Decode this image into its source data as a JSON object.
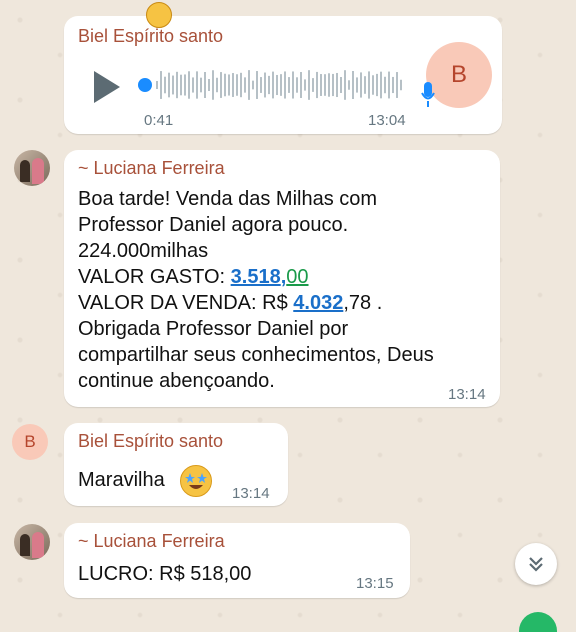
{
  "voice_message": {
    "sender": "Biel Espírito santo",
    "duration": "0:41",
    "time": "13:04",
    "avatar_letter": "B"
  },
  "message1": {
    "sender": "~ Luciana Ferreira",
    "line1": "Boa tarde! Venda das Milhas com",
    "line2": "Professor Daniel agora pouco.",
    "line3": "224.000milhas",
    "gasto_label": "VALOR GASTO: ",
    "gasto_int": "3.518",
    "gasto_sep": ",",
    "gasto_dec": "00",
    "venda_label": "VALOR DA VENDA: R$ ",
    "venda_int": "4.032",
    "venda_rest": ",78 .",
    "line6": "Obrigada Professor Daniel por",
    "line7": "compartilhar seus conhecimentos, Deus",
    "line8": "continue abençoando.",
    "time": "13:14"
  },
  "message2": {
    "avatar_letter": "B",
    "sender": "Biel Espírito santo",
    "text": "Maravilha",
    "time": "13:14"
  },
  "message3": {
    "sender": "~ Luciana Ferreira",
    "text": "LUCRO: R$ 518,00",
    "time": "13:15"
  },
  "colors": {
    "sender_name": "#a8513a",
    "link": "#1a6fc9",
    "play_dot": "#1a8cff",
    "mic": "#1a8cff"
  }
}
